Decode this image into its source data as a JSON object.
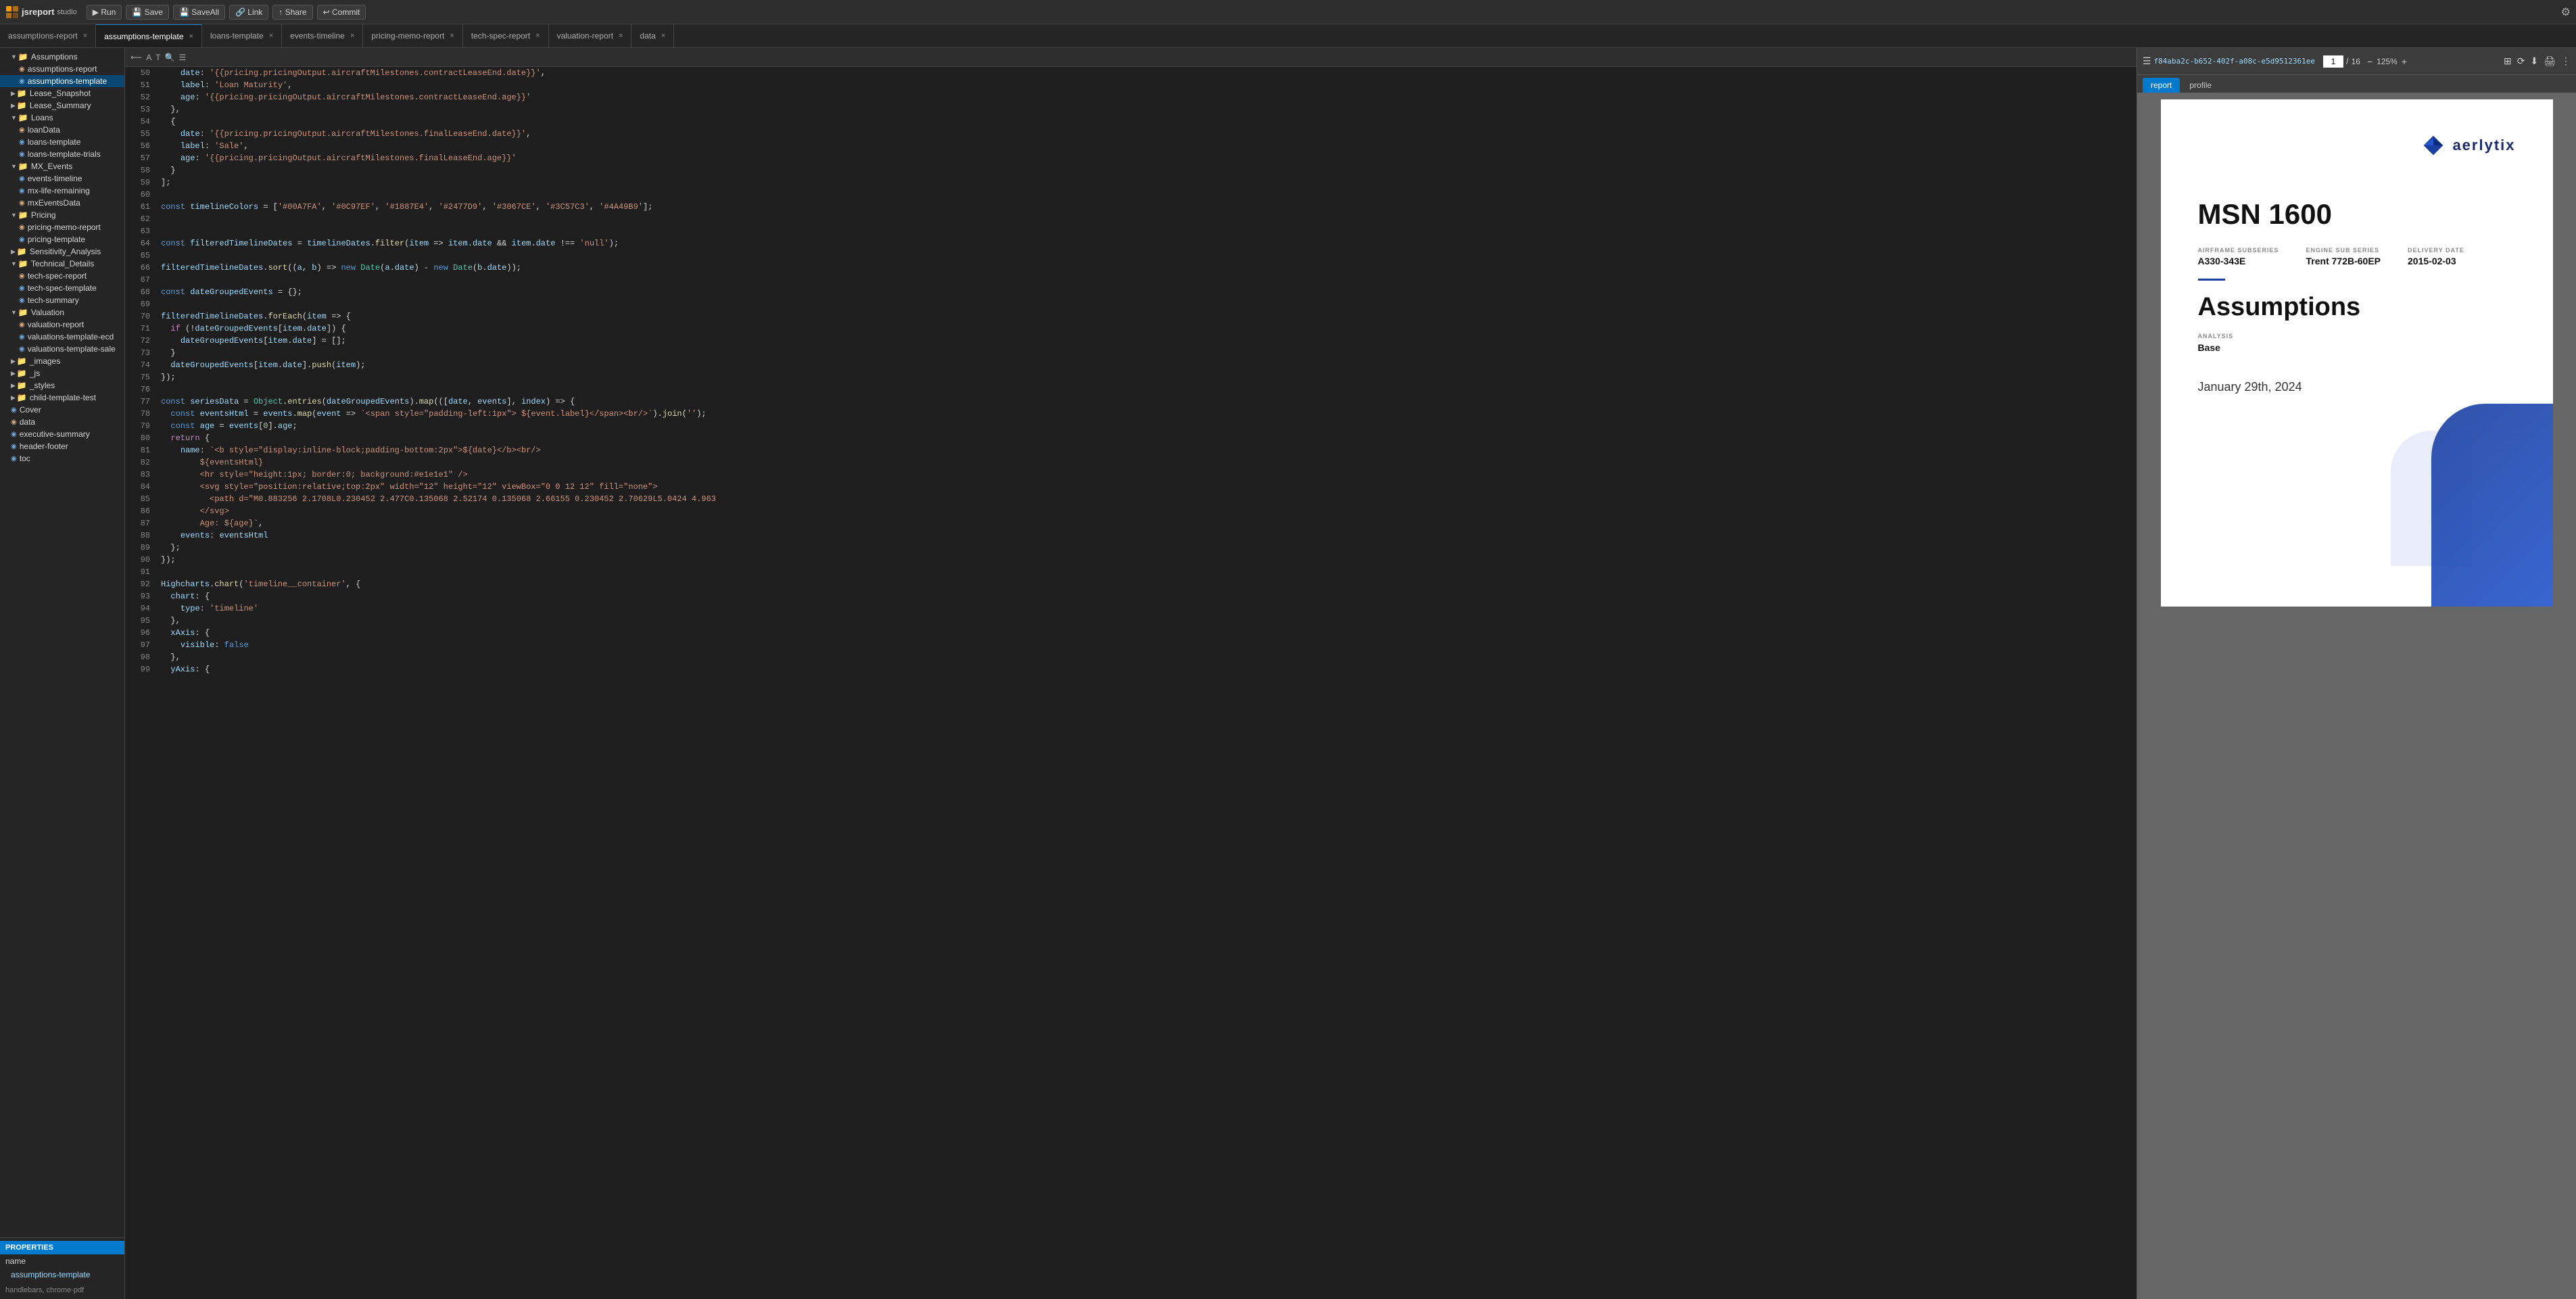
{
  "toolbar": {
    "logo_text": "jsreport",
    "logo_studio": "studio",
    "run_label": "▶ Run",
    "save_label": "💾 Save",
    "save_all_label": "💾 SaveAll",
    "link_label": "🔗 Link",
    "share_label": "↑ Share",
    "commit_label": "↩ Commit"
  },
  "tabs": [
    {
      "id": "assumptions-report",
      "label": "assumptions-report",
      "active": false
    },
    {
      "id": "assumptions-template",
      "label": "assumptions-template",
      "active": true
    },
    {
      "id": "loans-template",
      "label": "loans-template",
      "active": false
    },
    {
      "id": "events-timeline",
      "label": "events-timeline",
      "active": false
    },
    {
      "id": "pricing-memo-report",
      "label": "pricing-memo-report",
      "active": false
    },
    {
      "id": "tech-spec-report",
      "label": "tech-spec-report",
      "active": false
    },
    {
      "id": "valuation-report",
      "label": "valuation-report",
      "active": false
    },
    {
      "id": "data",
      "label": "data",
      "active": false
    }
  ],
  "sidebar": {
    "folders": [
      {
        "name": "Assumptions",
        "expanded": true,
        "indent": 1,
        "items": [
          {
            "name": "assumptions-report",
            "indent": 2
          },
          {
            "name": "assumptions-template",
            "indent": 2,
            "active": true
          }
        ]
      },
      {
        "name": "Lease_Snapshot",
        "expanded": false,
        "indent": 1
      },
      {
        "name": "Lease_Summary",
        "expanded": false,
        "indent": 1
      },
      {
        "name": "Loans",
        "expanded": true,
        "indent": 1,
        "items": [
          {
            "name": "loanData",
            "indent": 2
          },
          {
            "name": "loans-template",
            "indent": 2
          },
          {
            "name": "loans-template-trials",
            "indent": 2
          }
        ]
      },
      {
        "name": "MX_Events",
        "expanded": true,
        "indent": 1,
        "items": [
          {
            "name": "events-timeline",
            "indent": 2
          },
          {
            "name": "mx-life-remaining",
            "indent": 2
          },
          {
            "name": "mxEventsData",
            "indent": 2
          }
        ]
      },
      {
        "name": "Pricing",
        "expanded": true,
        "indent": 1,
        "items": [
          {
            "name": "pricing-memo-report",
            "indent": 2
          },
          {
            "name": "pricing-template",
            "indent": 2
          }
        ]
      },
      {
        "name": "Sensitivity_Analysis",
        "expanded": false,
        "indent": 1
      },
      {
        "name": "Technical_Details",
        "expanded": true,
        "indent": 1,
        "items": [
          {
            "name": "tech-spec-report",
            "indent": 2
          },
          {
            "name": "tech-spec-template",
            "indent": 2
          },
          {
            "name": "tech-summary",
            "indent": 2
          }
        ]
      },
      {
        "name": "Valuation",
        "expanded": true,
        "indent": 1,
        "items": [
          {
            "name": "valuation-report",
            "indent": 2
          },
          {
            "name": "valuations-template-ecd",
            "indent": 2
          },
          {
            "name": "valuations-template-sale",
            "indent": 2
          }
        ]
      },
      {
        "name": "_images",
        "expanded": false,
        "indent": 1
      },
      {
        "name": "_js",
        "expanded": false,
        "indent": 1
      },
      {
        "name": "_styles",
        "expanded": false,
        "indent": 1
      },
      {
        "name": "child-template-test",
        "expanded": false,
        "indent": 1
      },
      {
        "name": "Cover",
        "indent": 1,
        "file": true
      },
      {
        "name": "data",
        "indent": 1,
        "file": true
      },
      {
        "name": "executive-summary",
        "indent": 1,
        "file": true
      },
      {
        "name": "header-footer",
        "indent": 1,
        "file": true
      },
      {
        "name": "toc",
        "indent": 1,
        "file": true
      }
    ],
    "properties_title": "Properties",
    "props": [
      {
        "key": "name",
        "value": ""
      },
      {
        "key": "assumptions-template",
        "value": ""
      }
    ],
    "bottom_label": "handlebars, chrome-pdf"
  },
  "editor": {
    "mini_toolbar": {
      "icons": [
        "⟵",
        "A",
        "T",
        "🔍",
        "☰"
      ]
    },
    "lines": [
      {
        "num": 50,
        "code": "    date: '{{pricing.pricingOutput.aircraftMilestones.contractLeaseEnd.date}}',",
        "highlight": false
      },
      {
        "num": 51,
        "code": "    label: 'Loan Maturity',",
        "highlight": false
      },
      {
        "num": 52,
        "code": "    age: '{{pricing.pricingOutput.aircraftMilestones.contractLeaseEnd.age}}'",
        "highlight": false
      },
      {
        "num": 53,
        "code": "  },",
        "highlight": false
      },
      {
        "num": 54,
        "code": "  {",
        "highlight": false
      },
      {
        "num": 55,
        "code": "    date: '{{pricing.pricingOutput.aircraftMilestones.finalLeaseEnd.date}}',",
        "highlight": false
      },
      {
        "num": 56,
        "code": "    label: 'Sale',",
        "highlight": false
      },
      {
        "num": 57,
        "code": "    age: '{{pricing.pricingOutput.aircraftMilestones.finalLeaseEnd.age}}'",
        "highlight": false
      },
      {
        "num": 58,
        "code": "  }",
        "highlight": false
      },
      {
        "num": 59,
        "code": "];",
        "highlight": false
      },
      {
        "num": 60,
        "code": "",
        "highlight": false
      },
      {
        "num": 61,
        "code": "const timelineColors = ['#00A7FA', '#0C97EF', '#1887E4', '#2477D9', '#3067CE', '#3C57C3', '#4A49B9'];",
        "highlight": false
      },
      {
        "num": 62,
        "code": "",
        "highlight": false
      },
      {
        "num": 63,
        "code": "",
        "highlight": false
      },
      {
        "num": 64,
        "code": "const filteredTimelineDates = timelineDates.filter(item => item.date && item.date !== 'null');",
        "highlight": false
      },
      {
        "num": 65,
        "code": "",
        "highlight": false
      },
      {
        "num": 66,
        "code": "filteredTimelineDates.sort((a, b) => new Date(a.date) - new Date(b.date));",
        "highlight": false
      },
      {
        "num": 67,
        "code": "",
        "highlight": false
      },
      {
        "num": 68,
        "code": "const dateGroupedEvents = {};",
        "highlight": false
      },
      {
        "num": 69,
        "code": "",
        "highlight": false
      },
      {
        "num": 70,
        "code": "filteredTimelineDates.forEach(item => {",
        "highlight": false
      },
      {
        "num": 71,
        "code": "  if (!dateGroupedEvents[item.date]) {",
        "highlight": false
      },
      {
        "num": 72,
        "code": "    dateGroupedEvents[item.date] = [];",
        "highlight": false
      },
      {
        "num": 73,
        "code": "  }",
        "highlight": false
      },
      {
        "num": 74,
        "code": "  dateGroupedEvents[item.date].push(item);",
        "highlight": false
      },
      {
        "num": 75,
        "code": "});",
        "highlight": false
      },
      {
        "num": 76,
        "code": "",
        "highlight": false
      },
      {
        "num": 77,
        "code": "const seriesData = Object.entries(dateGroupedEvents).map(([date, events], index) => {",
        "highlight": false
      },
      {
        "num": 78,
        "code": "  const eventsHtml = events.map(event => `<span style=\"padding-left:1px\"> ${event.label}</span><br/>`).join('');",
        "highlight": false
      },
      {
        "num": 79,
        "code": "  const age = events[0].age;",
        "highlight": false
      },
      {
        "num": 80,
        "code": "  return {",
        "highlight": false
      },
      {
        "num": 81,
        "code": "    name: `<b style=\"display:inline-block;padding-bottom:2px\">${date}</b><br/>",
        "highlight": false
      },
      {
        "num": 82,
        "code": "        ${eventsHtml}",
        "highlight": false
      },
      {
        "num": 83,
        "code": "        <hr style=\"height:1px; border:0; background:#e1e1e1\" />",
        "highlight": false
      },
      {
        "num": 84,
        "code": "        <svg style=\"position:relative;top:2px\" width=\"12\" height=\"12\" viewBox=\"0 0 12 12\" fill=\"none\">",
        "highlight": false
      },
      {
        "num": 85,
        "code": "          <path d=\"M0.883256 2.1708L0.230452 2.477C0.135068 2.52174 0.135068 2.66155 0.230452 2.70629L5.0424 4.963",
        "highlight": false
      },
      {
        "num": 86,
        "code": "        </svg>",
        "highlight": false
      },
      {
        "num": 87,
        "code": "        Age: ${age}`,",
        "highlight": false
      },
      {
        "num": 88,
        "code": "    events: eventsHtml",
        "highlight": false
      },
      {
        "num": 89,
        "code": "  };",
        "highlight": false
      },
      {
        "num": 90,
        "code": "});",
        "highlight": false
      },
      {
        "num": 91,
        "code": "",
        "highlight": false
      },
      {
        "num": 92,
        "code": "Highcharts.chart('timeline__container', {",
        "highlight": false
      },
      {
        "num": 93,
        "code": "  chart: {",
        "highlight": false
      },
      {
        "num": 94,
        "code": "    type: 'timeline'",
        "highlight": false
      },
      {
        "num": 95,
        "code": "  },",
        "highlight": false
      },
      {
        "num": 96,
        "code": "  xAxis: {",
        "highlight": false
      },
      {
        "num": 97,
        "code": "    visible: false",
        "highlight": false
      },
      {
        "num": 98,
        "code": "  },",
        "highlight": false
      },
      {
        "num": 99,
        "code": "  yAxis: {",
        "highlight": false
      }
    ]
  },
  "preview": {
    "toolbar": {
      "menu_icon": "☰",
      "file_id": "f84aba2c-b652-402f-a08c-e5d9512361ee",
      "page_current": "1",
      "page_total": "16",
      "zoom_minus": "−",
      "zoom_value": "125%",
      "zoom_plus": "+",
      "icons_right": [
        "⊞",
        "⟳",
        "⬇",
        "🖨",
        "⋮"
      ]
    },
    "tabs": [
      {
        "label": "report",
        "active": true
      },
      {
        "label": "profile",
        "active": false
      }
    ],
    "pdf": {
      "logo_text": "aerlytix",
      "msn_label": "MSN 1600",
      "meta": [
        {
          "label": "AIRFRAME SUBSERIES",
          "value": "A330-343E"
        },
        {
          "label": "ENGINE SUB SERIES",
          "value": "Trent 772B-60EP"
        },
        {
          "label": "DELIVERY DATE",
          "value": "2015-02-03"
        }
      ],
      "section_title": "Assumptions",
      "analysis_label": "ANALYSIS",
      "analysis_value": "Base",
      "date": "January 29th, 2024"
    }
  }
}
